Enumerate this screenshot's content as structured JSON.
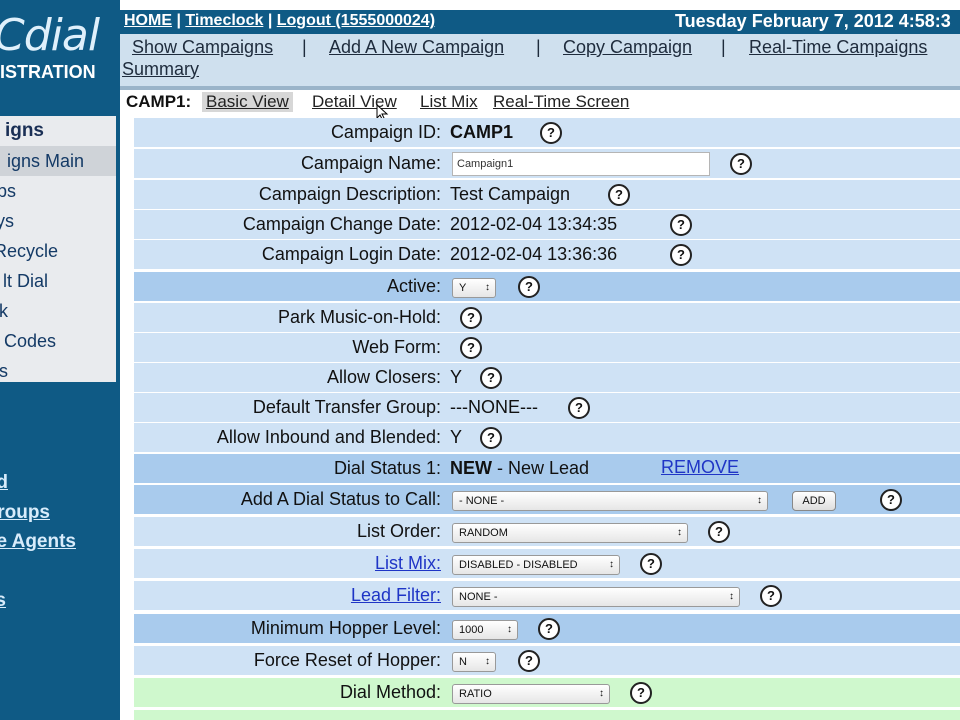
{
  "colors": {
    "header": "#0f5a85",
    "row_light": "#cfe2f5",
    "row_dark": "#a9cbed",
    "row_green": "#cff8cd",
    "link": "#1f35c6"
  },
  "logo": {
    "text": "Cdial",
    "sub": "ISTRATION"
  },
  "header": {
    "links": [
      "HOME",
      "Timeclock",
      "Logout (1555000024)"
    ],
    "separator": "|",
    "date": "Tuesday February 7, 2012 4:58:3"
  },
  "subnav": {
    "items": [
      "Show Campaigns",
      "Add A New Campaign",
      "Copy Campaign",
      "Real-Time Campaigns",
      "Summary"
    ],
    "separator": "|"
  },
  "sidebar": {
    "items": [
      "igns",
      "igns Main",
      "ps",
      "ys",
      "Recycle",
      "lt Dial",
      "k",
      "Codes",
      "s"
    ]
  },
  "rail_links": [
    "d",
    "roups",
    "e Agents",
    "s"
  ],
  "tabs": {
    "campaign": "CAMP1:",
    "items": [
      "Basic View",
      "Detail View",
      "List Mix",
      "Real-Time Screen"
    ]
  },
  "help_glyph": "?",
  "form": {
    "campaign_id": {
      "label": "Campaign ID:",
      "value": "CAMP1"
    },
    "campaign_name": {
      "label": "Campaign Name:",
      "value": "Campaign1"
    },
    "campaign_description": {
      "label": "Campaign Description:",
      "value": "Test Campaign"
    },
    "change_date": {
      "label": "Campaign Change Date:",
      "value": "2012-02-04 13:34:35"
    },
    "login_date": {
      "label": "Campaign Login Date:",
      "value": "2012-02-04 13:36:36"
    },
    "active": {
      "label": "Active:",
      "value": "Y"
    },
    "park_music": {
      "label": "Park Music-on-Hold:"
    },
    "web_form": {
      "label": "Web Form:"
    },
    "allow_closers": {
      "label": "Allow Closers:",
      "value": "Y"
    },
    "transfer_group": {
      "label": "Default Transfer Group:",
      "value": "---NONE---"
    },
    "inbound_blended": {
      "label": "Allow Inbound and Blended:",
      "value": "Y"
    },
    "dial_status": {
      "label": "Dial Status 1:",
      "code": "NEW",
      "desc": " - New Lead",
      "action": "REMOVE"
    },
    "add_dial_status": {
      "label": "Add A Dial Status to Call:",
      "value": "- NONE -",
      "button": "ADD"
    },
    "list_order": {
      "label": "List Order:",
      "value": "RANDOM"
    },
    "list_mix": {
      "label": "List Mix:",
      "value": "DISABLED - DISABLED"
    },
    "lead_filter": {
      "label": "Lead Filter:",
      "value": "NONE -"
    },
    "min_hopper": {
      "label": "Minimum Hopper Level:",
      "value": "1000"
    },
    "force_reset": {
      "label": "Force Reset of Hopper:",
      "value": "N"
    },
    "dial_method": {
      "label": "Dial Method:",
      "value": "RATIO"
    }
  }
}
